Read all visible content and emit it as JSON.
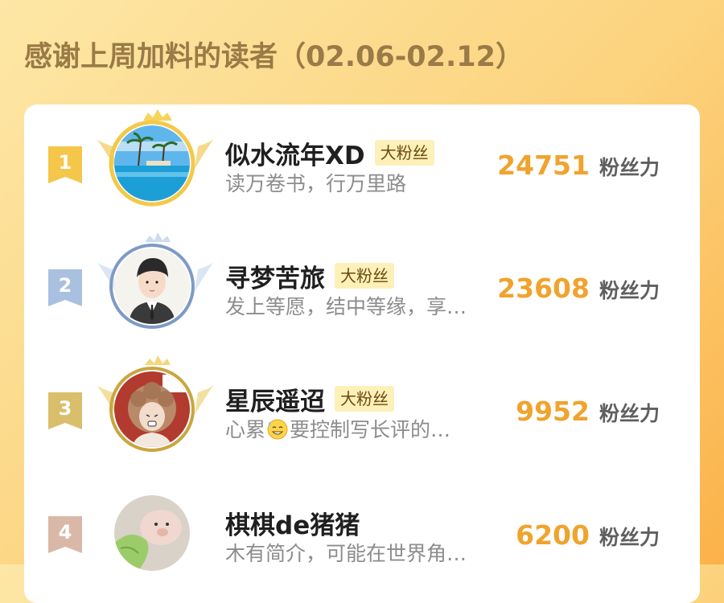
{
  "title": "感谢上周加料的读者（02.06-02.12）",
  "colors": {
    "score": "#f0a32d",
    "rank_gold": "#f4c64a",
    "rank_silver": "#a9c0e0",
    "rank_bronze": "#d9bf6b",
    "rank_fourth": "#d9b8a8"
  },
  "readers": [
    {
      "rank": "1",
      "name": "似水流年XD",
      "badge": "大粉丝",
      "bio": "读万卷书，行万里路",
      "score": "24751",
      "unit": "粉丝力"
    },
    {
      "rank": "2",
      "name": "寻梦苦旅",
      "badge": "大粉丝",
      "bio": "发上等愿，结中等缘，享…",
      "score": "23608",
      "unit": "粉丝力"
    },
    {
      "rank": "3",
      "name": "星辰遥迢",
      "badge": "大粉丝",
      "bio_before": "心累",
      "bio_emoji": "sweat-smile-emoji",
      "bio_after": "要控制写长评的…",
      "score": "9952",
      "unit": "粉丝力"
    },
    {
      "rank": "4",
      "name": "棋棋de猪猪",
      "badge": "",
      "bio": "木有简介，可能在世界角…",
      "score": "6200",
      "unit": "粉丝力"
    }
  ]
}
